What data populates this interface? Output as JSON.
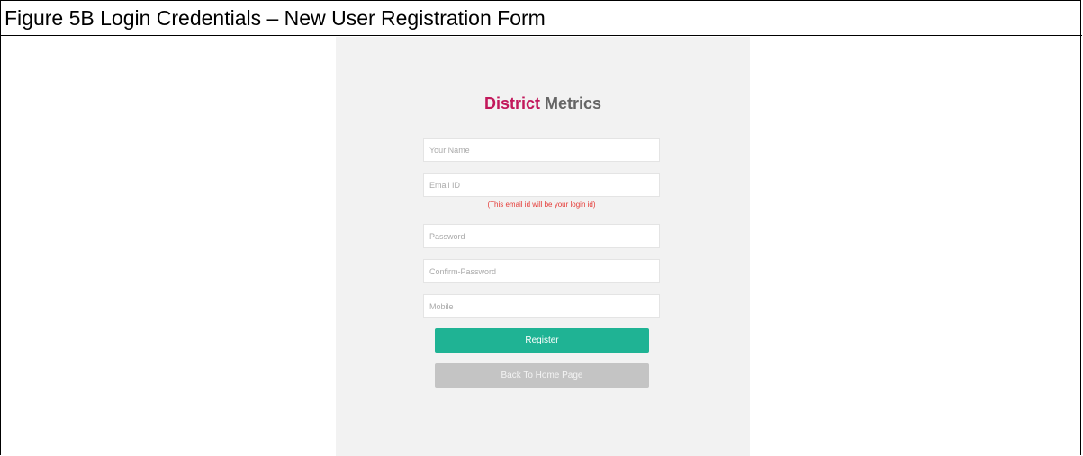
{
  "caption": "Figure 5B Login Credentials – New User Registration Form",
  "brand": {
    "part1": "District",
    "part2": "Metrics"
  },
  "form": {
    "name_placeholder": "Your Name",
    "email_placeholder": "Email ID",
    "email_hint": "(This email id will be your login id)",
    "password_placeholder": "Password",
    "confirm_password_placeholder": "Confirm-Password",
    "mobile_placeholder": "Mobile",
    "register_label": "Register",
    "home_label": "Back To Home Page"
  },
  "colors": {
    "brand_accent": "#c2185b",
    "brand_secondary": "#666666",
    "register_button": "#1fb394",
    "home_button": "#c4c4c4",
    "hint_text": "#e53935",
    "panel_background": "#f2f2f2"
  }
}
